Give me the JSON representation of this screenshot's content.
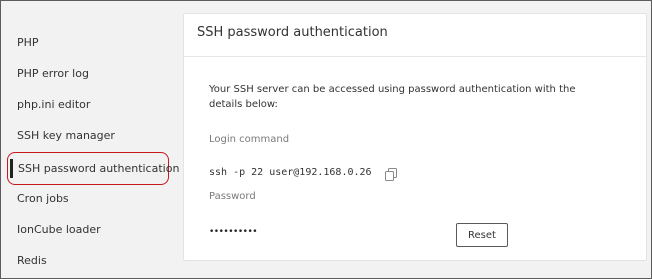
{
  "sidebar": {
    "items": [
      {
        "label": "PHP"
      },
      {
        "label": "PHP error log"
      },
      {
        "label": "php.ini editor"
      },
      {
        "label": "SSH key manager"
      },
      {
        "label": "SSH password authentication",
        "active": true
      },
      {
        "label": "Cron jobs"
      },
      {
        "label": "IonCube loader"
      },
      {
        "label": "Redis"
      }
    ]
  },
  "panel": {
    "title": "SSH password authentication",
    "description": "Your SSH server can be accessed using password authentication with the details below:",
    "login_label": "Login command",
    "login_command": "ssh -p 22 user@192.168.0.26",
    "password_label": "Password",
    "password_mask": "••••••••••",
    "reset_label": "Reset"
  },
  "icons": {
    "copy": "copy-icon"
  },
  "colors": {
    "highlight": "#c8191f",
    "panel_bg": "#ffffff",
    "page_bg": "#f2f2f2"
  }
}
